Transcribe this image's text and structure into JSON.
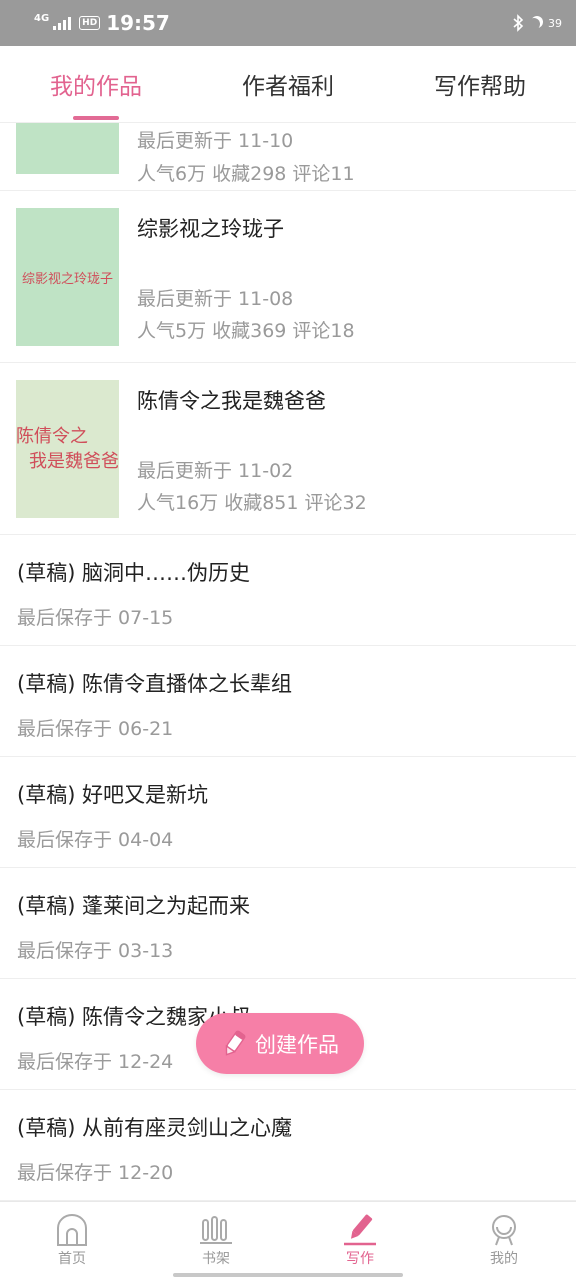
{
  "status_bar": {
    "network": "4G",
    "hd": "HD",
    "time": "19:57",
    "battery": "39"
  },
  "tabs": [
    {
      "label": "我的作品",
      "active": true
    },
    {
      "label": "作者福利",
      "active": false
    },
    {
      "label": "写作帮助",
      "active": false
    }
  ],
  "books": [
    {
      "title": "",
      "cover_text": "",
      "last_update": "最后更新于 11-10",
      "stats": "人气6万  收藏298  评论11"
    },
    {
      "title": "综影视之玲珑子",
      "cover_text": "综影视之玲珑子",
      "last_update": "最后更新于 11-08",
      "stats": "人气5万  收藏369  评论18"
    },
    {
      "title": "陈倩令之我是魏爸爸",
      "cover_text_line1": "陈倩令之",
      "cover_text_line2": "我是魏爸爸",
      "last_update": "最后更新于 11-02",
      "stats": "人气16万  收藏851  评论32"
    }
  ],
  "drafts": [
    {
      "title": "(草稿) 脑洞中……伪历史",
      "saved": "最后保存于 07-15"
    },
    {
      "title": "(草稿) 陈倩令直播体之长辈组",
      "saved": "最后保存于 06-21"
    },
    {
      "title": "(草稿) 好吧又是新坑",
      "saved": "最后保存于 04-04"
    },
    {
      "title": "(草稿) 蓬莱间之为起而来",
      "saved": "最后保存于 03-13"
    },
    {
      "title": "(草稿) 陈倩令之魏家小叔",
      "saved": "最后保存于 12-24"
    },
    {
      "title": "(草稿) 从前有座灵剑山之心魔",
      "saved": "最后保存于 12-20"
    }
  ],
  "fab": {
    "label": "创建作品",
    "icon": "pencil-icon"
  },
  "bottom_nav": [
    {
      "label": "首页",
      "icon": "home-icon",
      "active": false
    },
    {
      "label": "书架",
      "icon": "bookshelf-icon",
      "active": false
    },
    {
      "label": "写作",
      "icon": "pen-icon",
      "active": true
    },
    {
      "label": "我的",
      "icon": "profile-icon",
      "active": false
    }
  ],
  "colors": {
    "accent": "#e2638f",
    "fab": "#f67fa7",
    "status_bar": "#9a9a9a",
    "cover_green": "#bfe3c5",
    "cover_text": "#d04e5a"
  }
}
